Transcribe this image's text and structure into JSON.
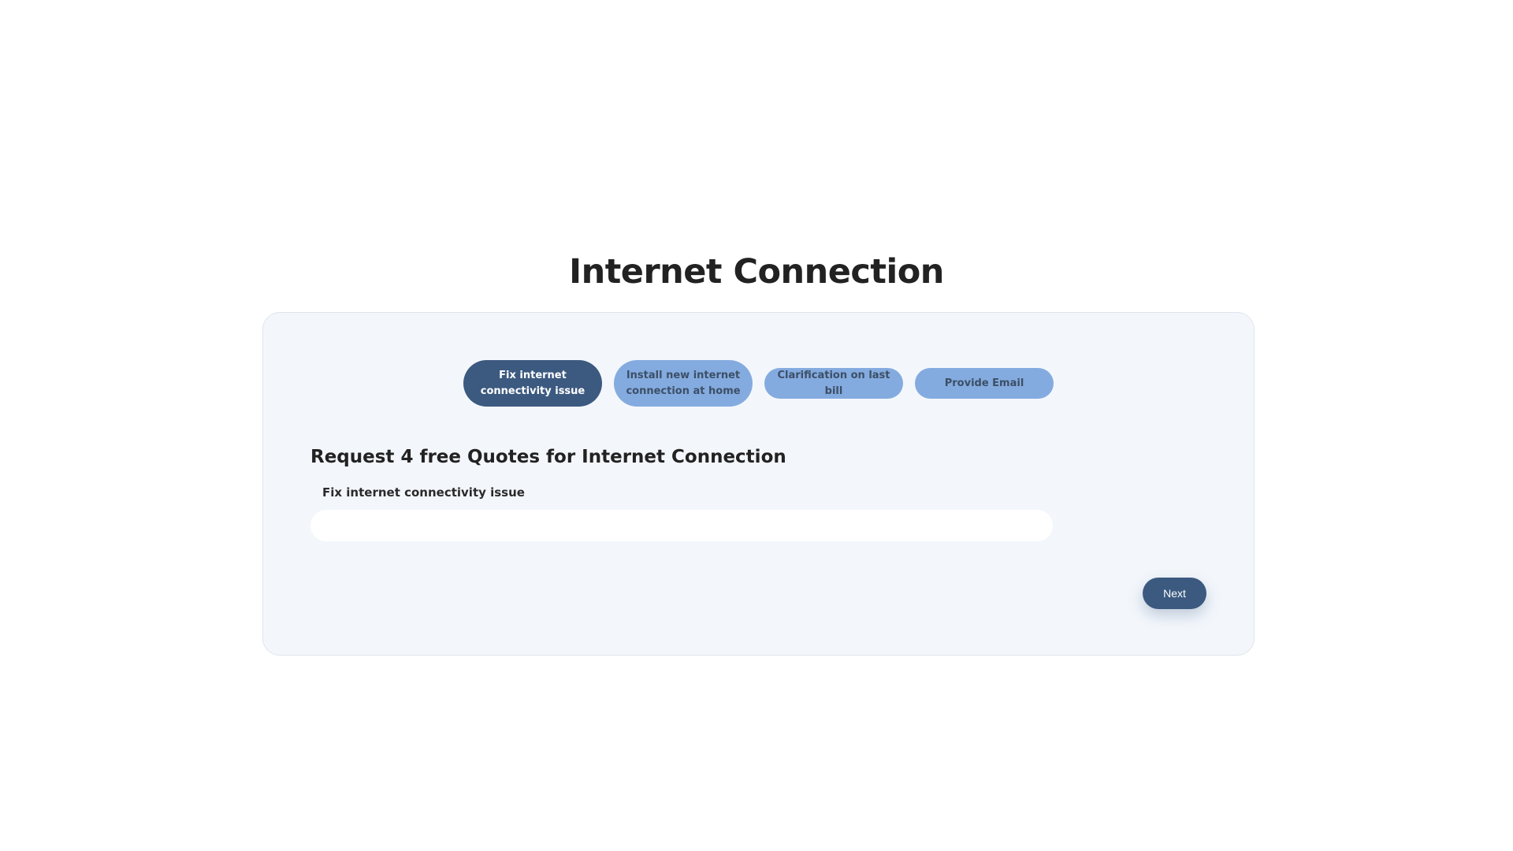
{
  "page": {
    "title": "Internet Connection"
  },
  "tabs": [
    {
      "label": "Fix internet connectivity issue",
      "active": true
    },
    {
      "label": "Install new internet connection at home",
      "active": false
    },
    {
      "label": "Clarification on last bill",
      "active": false
    },
    {
      "label": "Provide Email",
      "active": false
    }
  ],
  "form": {
    "heading": "Request 4 free Quotes for Internet Connection",
    "field_label": "Fix internet connectivity issue",
    "field_value": "",
    "next_label": "Next"
  },
  "colors": {
    "active_tab": "#3c5a80",
    "inactive_tab": "#84abdf",
    "card_background": "#f3f7fc",
    "button": "#3c5a80"
  }
}
